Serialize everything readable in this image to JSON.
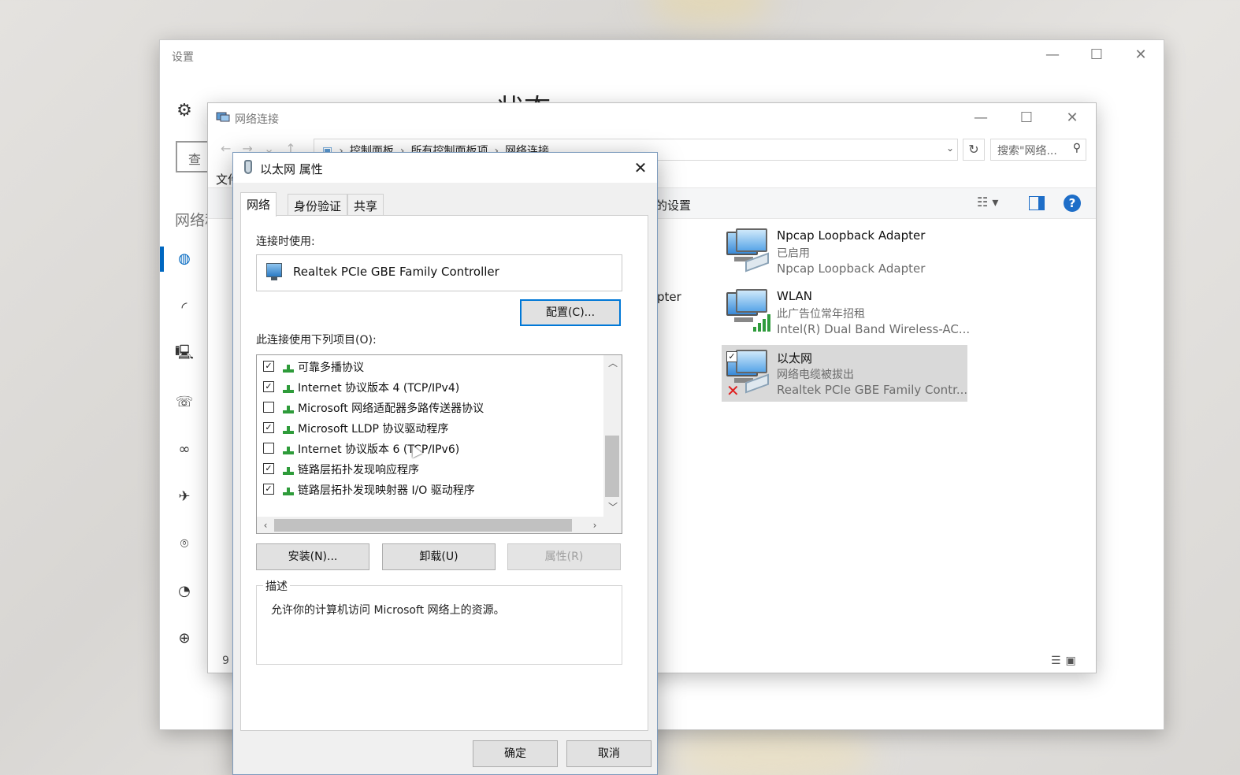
{
  "settings": {
    "title": "设置",
    "search_fragment": "查找",
    "nav_header_fragment": "网络和",
    "page_title_fragment": "状态",
    "controls": {
      "minimize": "—",
      "maximize": "☐",
      "close": "✕"
    }
  },
  "netconn": {
    "title": "网络连接",
    "breadcrumb": [
      "控制面板",
      "所有控制面板项",
      "网络连接"
    ],
    "search_placeholder": "搜索\"网络...",
    "menu_file": "文件",
    "cmd_settings_fragment": "的设置",
    "fragment_pter": "pter",
    "item_count_fragment": "9",
    "controls": {
      "minimize": "—",
      "maximize": "☐",
      "close": "✕"
    },
    "adapters": [
      {
        "name": "Npcap Loopback Adapter",
        "status": "已启用",
        "device": "Npcap Loopback Adapter",
        "kind": "wired",
        "selected": false
      },
      {
        "name": "WLAN",
        "status": "此广告位常年招租",
        "device": "Intel(R) Dual Band Wireless-AC...",
        "kind": "wireless",
        "selected": false
      },
      {
        "name": "以太网",
        "status": "网络电缆被拔出",
        "device": "Realtek PCIe GBE Family Contr...",
        "kind": "wired-disconnected",
        "selected": true
      }
    ]
  },
  "dialog": {
    "title": "以太网 属性",
    "close": "✕",
    "tabs": [
      {
        "label": "网络",
        "active": true
      },
      {
        "label": "身份验证",
        "active": false
      },
      {
        "label": "共享",
        "active": false
      }
    ],
    "connect_using_label": "连接时使用:",
    "adapter_name": "Realtek PCIe GBE Family Controller",
    "configure_button": "配置(C)...",
    "items_label": "此连接使用下列项目(O):",
    "items": [
      {
        "label": "可靠多播协议",
        "checked": true
      },
      {
        "label": "Internet 协议版本 4 (TCP/IPv4)",
        "checked": true
      },
      {
        "label": "Microsoft 网络适配器多路传送器协议",
        "checked": false
      },
      {
        "label": "Microsoft LLDP 协议驱动程序",
        "checked": true
      },
      {
        "label": "Internet 协议版本 6 (TCP/IPv6)",
        "checked": false
      },
      {
        "label": "链路层拓扑发现响应程序",
        "checked": true
      },
      {
        "label": "链路层拓扑发现映射器 I/O 驱动程序",
        "checked": true
      }
    ],
    "install_button": "安装(N)...",
    "uninstall_button": "卸载(U)",
    "properties_button": "属性(R)",
    "description_legend": "描述",
    "description_text": "允许你的计算机访问 Microsoft 网络上的资源。",
    "ok_button": "确定",
    "cancel_button": "取消"
  }
}
